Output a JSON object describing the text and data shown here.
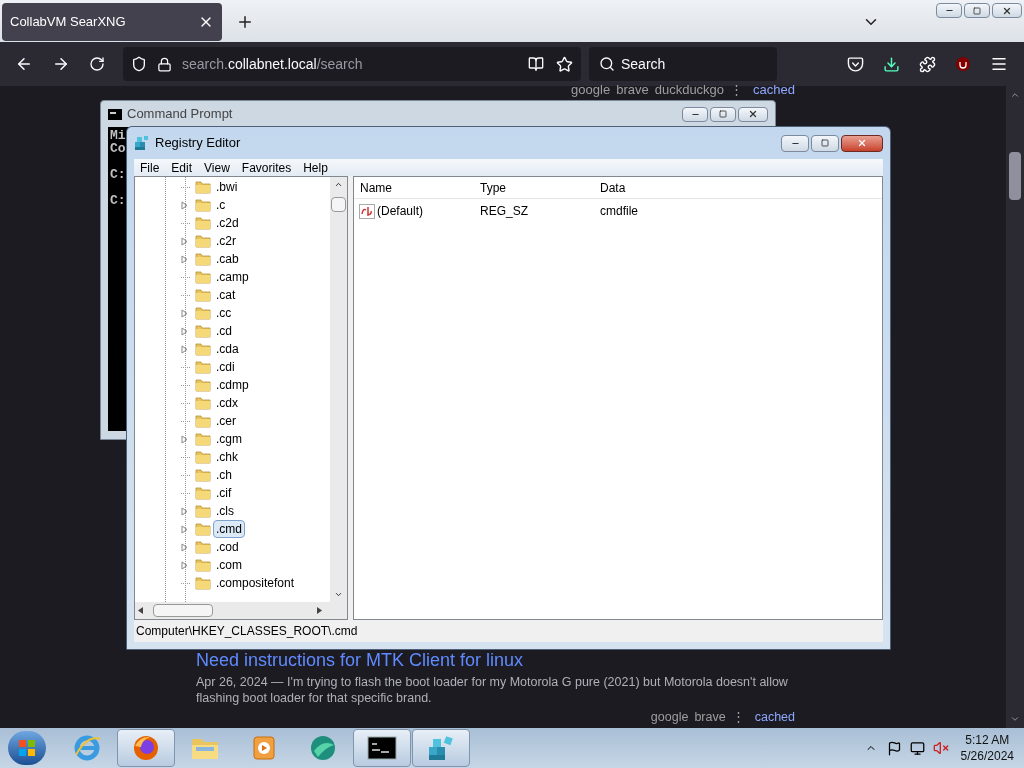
{
  "browser": {
    "tab": {
      "title": "CollabVM SearXNG",
      "selected": true
    },
    "address": {
      "prefix": "search.",
      "domain": "collabnet.local",
      "path": "/search"
    },
    "search": {
      "placeholder": "Search"
    }
  },
  "page": {
    "top_links": [
      "google",
      "brave",
      "duckduckgo",
      "⋮",
      "cached"
    ],
    "result": {
      "title": "Need instructions for MTK Client for linux",
      "snippet": "Apr 26, 2024 — I'm trying to flash the boot loader for my Motorola G pure (2021) but Motorola doesn't allow flashing boot loader for that specific brand.",
      "links": [
        "google",
        "brave",
        "⋮",
        "cached"
      ]
    }
  },
  "command_prompt": {
    "title": "Command Prompt",
    "lines": [
      "Mi",
      "Co",
      "C:",
      "C:"
    ]
  },
  "registry_editor": {
    "title": "Registry Editor",
    "menu": [
      "File",
      "Edit",
      "View",
      "Favorites",
      "Help"
    ],
    "tree": [
      {
        "label": ".bwi",
        "expandable": false,
        "selected": false
      },
      {
        "label": ".c",
        "expandable": true,
        "selected": false
      },
      {
        "label": ".c2d",
        "expandable": false,
        "selected": false
      },
      {
        "label": ".c2r",
        "expandable": true,
        "selected": false
      },
      {
        "label": ".cab",
        "expandable": true,
        "selected": false
      },
      {
        "label": ".camp",
        "expandable": false,
        "selected": false
      },
      {
        "label": ".cat",
        "expandable": false,
        "selected": false
      },
      {
        "label": ".cc",
        "expandable": true,
        "selected": false
      },
      {
        "label": ".cd",
        "expandable": true,
        "selected": false
      },
      {
        "label": ".cda",
        "expandable": true,
        "selected": false
      },
      {
        "label": ".cdi",
        "expandable": false,
        "selected": false
      },
      {
        "label": ".cdmp",
        "expandable": false,
        "selected": false
      },
      {
        "label": ".cdx",
        "expandable": false,
        "selected": false
      },
      {
        "label": ".cer",
        "expandable": false,
        "selected": false
      },
      {
        "label": ".cgm",
        "expandable": true,
        "selected": false
      },
      {
        "label": ".chk",
        "expandable": false,
        "selected": false
      },
      {
        "label": ".ch",
        "expandable": false,
        "selected": false
      },
      {
        "label": ".cif",
        "expandable": false,
        "selected": false
      },
      {
        "label": ".cls",
        "expandable": true,
        "selected": false
      },
      {
        "label": ".cmd",
        "expandable": true,
        "selected": true
      },
      {
        "label": ".cod",
        "expandable": true,
        "selected": false
      },
      {
        "label": ".com",
        "expandable": true,
        "selected": false
      },
      {
        "label": ".compositefont",
        "expandable": false,
        "selected": false
      }
    ],
    "columns": [
      "Name",
      "Type",
      "Data"
    ],
    "values": [
      {
        "name": "(Default)",
        "type": "REG_SZ",
        "data": "cmdfile"
      }
    ],
    "status": "Computer\\HKEY_CLASSES_ROOT\\.cmd"
  },
  "taskbar": {
    "apps": [
      {
        "kind": "ie",
        "active": false
      },
      {
        "kind": "firefox",
        "active": true
      },
      {
        "kind": "explorer",
        "active": false
      },
      {
        "kind": "media",
        "active": false
      },
      {
        "kind": "teal",
        "active": false
      },
      {
        "kind": "cmd",
        "active": true
      },
      {
        "kind": "regedit",
        "active": true
      }
    ],
    "time": "5:12 AM",
    "date": "5/26/2024"
  }
}
